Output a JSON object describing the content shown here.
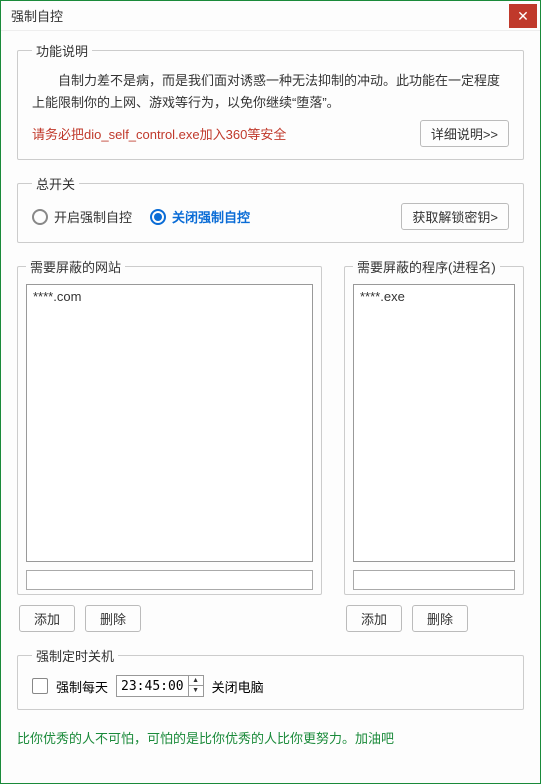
{
  "window": {
    "title": "强制自控"
  },
  "desc": {
    "legend": "功能说明",
    "text": "自制力差不是病，而是我们面对诱惑一种无法抑制的冲动。此功能在一定程度上能限制你的上网、游戏等行为，以免你继续“堕落”。",
    "warning": "请务必把dio_self_control.exe加入360等安全",
    "detail_btn": "详细说明>>"
  },
  "master": {
    "legend": "总开关",
    "on_label": "开启强制自控",
    "off_label": "关闭强制自控",
    "selected": "off",
    "unlock_btn": "获取解锁密钥>"
  },
  "sites": {
    "legend": "需要屏蔽的网站",
    "items": [
      "****.com"
    ],
    "input_value": "",
    "add_btn": "添加",
    "del_btn": "删除"
  },
  "procs": {
    "legend": "需要屏蔽的程序(进程名)",
    "items": [
      "****.exe"
    ],
    "input_value": "",
    "add_btn": "添加",
    "del_btn": "删除"
  },
  "shutdown": {
    "legend": "强制定时关机",
    "checked": false,
    "prefix": "强制每天",
    "time": "23:45:00",
    "suffix": "关闭电脑"
  },
  "footer": "比你优秀的人不可怕，可怕的是比你优秀的人比你更努力。加油吧"
}
